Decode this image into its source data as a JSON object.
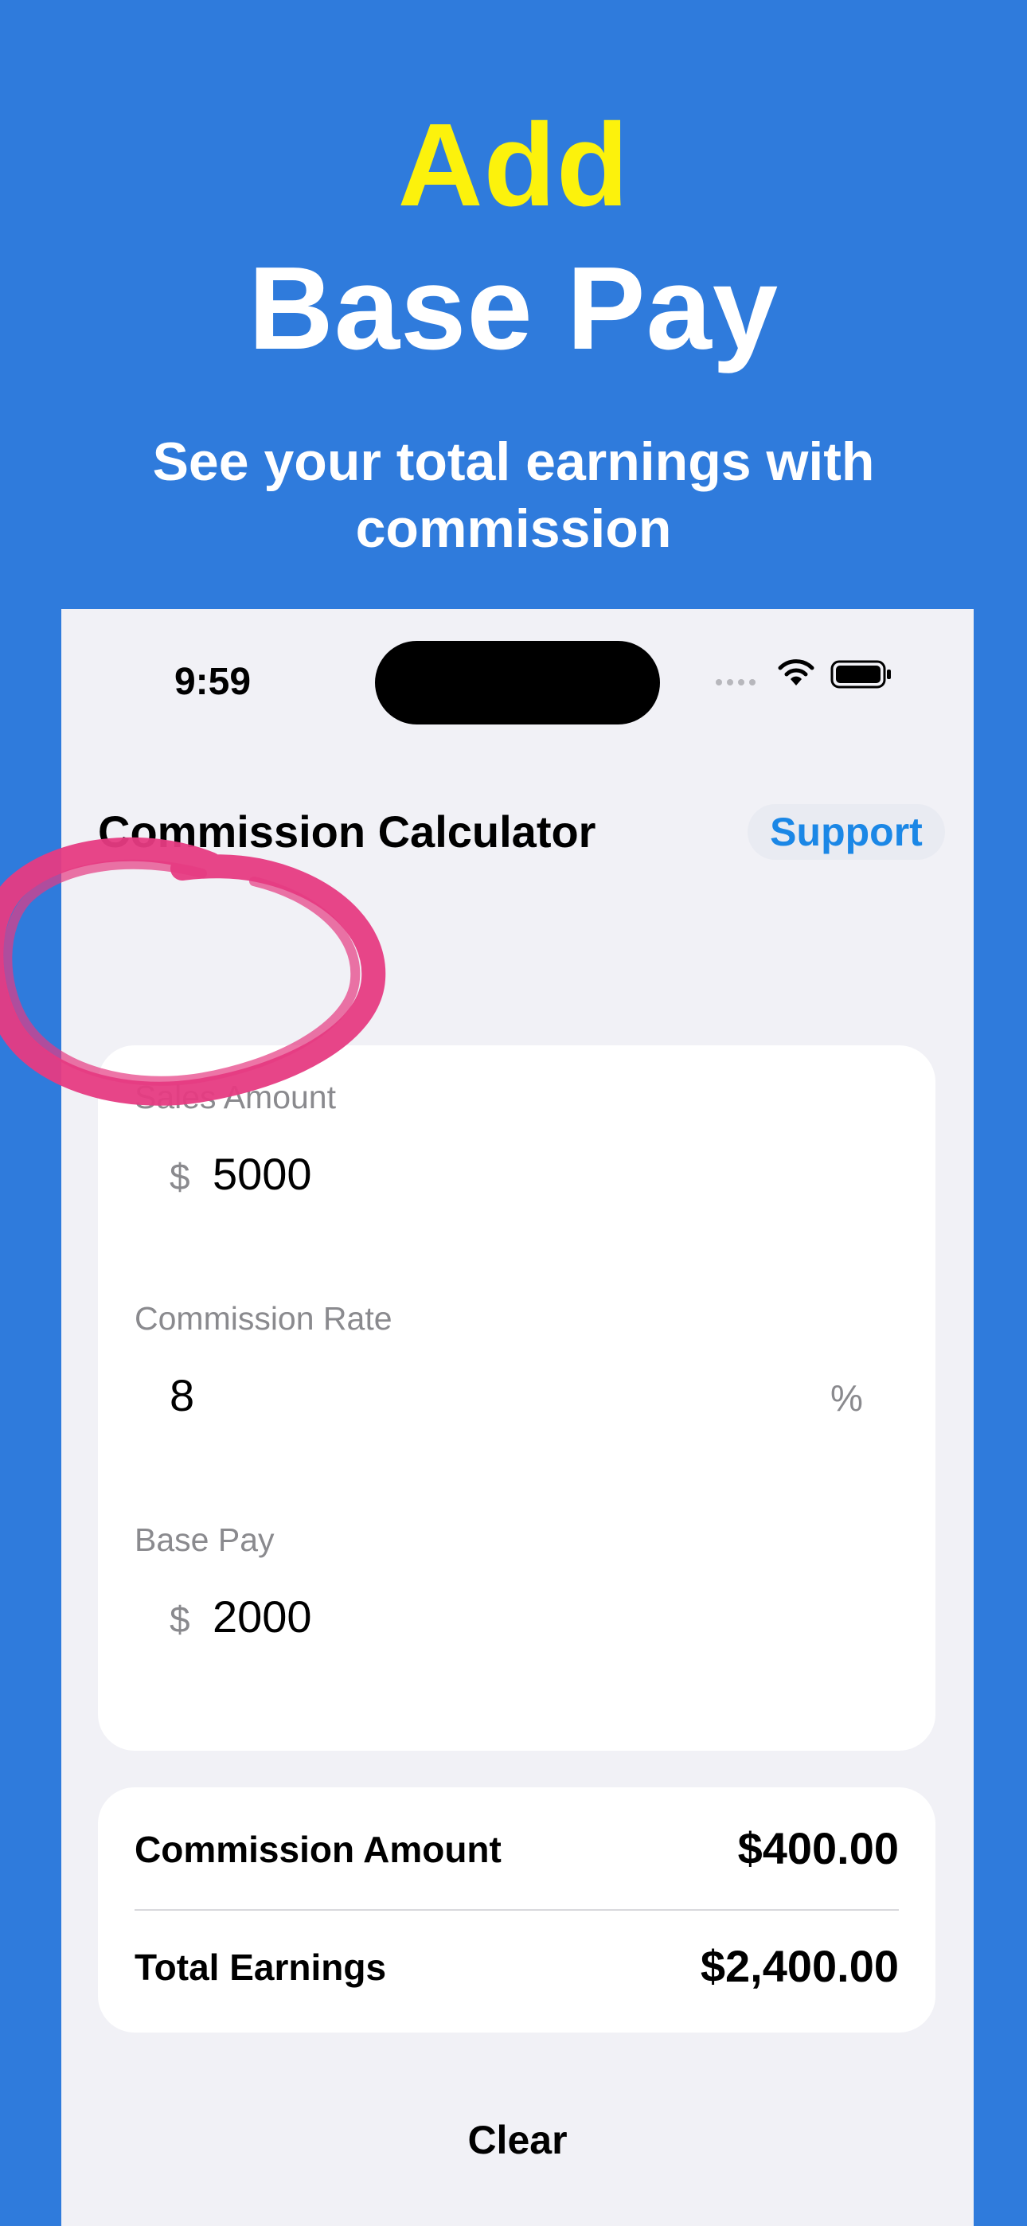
{
  "headline": {
    "line1": "Add",
    "line2": "Base Pay"
  },
  "subheadline": "See your total earnings with commission",
  "status_bar": {
    "time": "9:59"
  },
  "nav": {
    "title": "Commission Calculator",
    "support_label": "Support"
  },
  "inputs": {
    "sales_amount": {
      "label": "Sales Amount",
      "currency": "$",
      "value": "5000"
    },
    "commission_rate": {
      "label": "Commission Rate",
      "value": "8",
      "unit": "%"
    },
    "base_pay": {
      "label": "Base Pay",
      "currency": "$",
      "value": "2000"
    }
  },
  "results": {
    "commission_amount": {
      "label": "Commission Amount",
      "value": "$400.00"
    },
    "total_earnings": {
      "label": "Total Earnings",
      "value": "$2,400.00"
    }
  },
  "actions": {
    "clear_label": "Clear"
  },
  "colors": {
    "background": "#2f7bdc",
    "headline_accent": "#fcf20c",
    "link": "#1b87e6",
    "highlight_circle": "#e63b82"
  },
  "icons": [
    "cellular-signal-icon",
    "wifi-icon",
    "battery-icon"
  ]
}
